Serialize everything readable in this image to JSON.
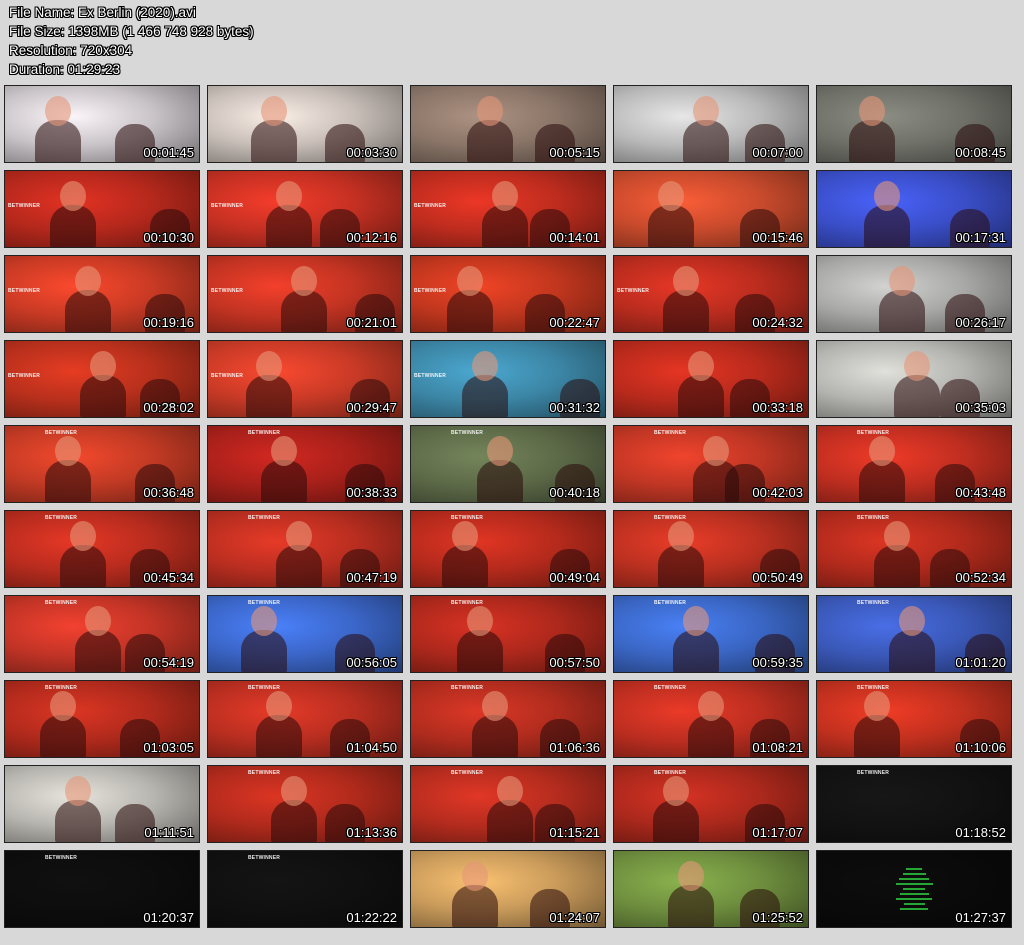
{
  "info": {
    "file_name": "File Name: Ex Berlin (2020).avi",
    "file_size": "File Size: 1398MB (1 466 748 928 bytes)",
    "resolution": "Resolution: 720x304",
    "duration": "Duration: 01:29:23"
  },
  "watermark": "BETWINNER",
  "thumbnails": [
    {
      "time": "00:01:45",
      "bg": "#c9c4c8",
      "tone": "light",
      "watermark": false
    },
    {
      "time": "00:03:30",
      "bg": "#c8beb8",
      "tone": "light",
      "watermark": false
    },
    {
      "time": "00:05:15",
      "bg": "#8a7568",
      "tone": "warm",
      "watermark": false
    },
    {
      "time": "00:07:00",
      "bg": "#b9b9b9",
      "tone": "light",
      "watermark": false
    },
    {
      "time": "00:08:45",
      "bg": "#6f7068",
      "tone": "dark",
      "watermark": false
    },
    {
      "time": "00:10:30",
      "bg": "#b5281c",
      "tone": "red",
      "watermark": true
    },
    {
      "time": "00:12:16",
      "bg": "#c43022",
      "tone": "red",
      "watermark": true
    },
    {
      "time": "00:14:01",
      "bg": "#bd2c1e",
      "tone": "red",
      "watermark": true
    },
    {
      "time": "00:15:46",
      "bg": "#c84a2c",
      "tone": "red",
      "watermark": false
    },
    {
      "time": "00:17:31",
      "bg": "#3a4ec8",
      "tone": "blue",
      "watermark": false
    },
    {
      "time": "00:19:16",
      "bg": "#c93a24",
      "tone": "red",
      "watermark": true
    },
    {
      "time": "00:21:01",
      "bg": "#c23322",
      "tone": "red",
      "watermark": true
    },
    {
      "time": "00:22:47",
      "bg": "#c0361e",
      "tone": "red",
      "watermark": true
    },
    {
      "time": "00:24:32",
      "bg": "#b92c1e",
      "tone": "red",
      "watermark": true
    },
    {
      "time": "00:26:17",
      "bg": "#a8a8a6",
      "tone": "light",
      "watermark": false
    },
    {
      "time": "00:28:02",
      "bg": "#b8301c",
      "tone": "red",
      "watermark": true
    },
    {
      "time": "00:29:47",
      "bg": "#c83a26",
      "tone": "red",
      "watermark": true
    },
    {
      "time": "00:31:32",
      "bg": "#3c86a6",
      "tone": "blue",
      "watermark": true
    },
    {
      "time": "00:33:18",
      "bg": "#b82a1c",
      "tone": "red",
      "watermark": false
    },
    {
      "time": "00:35:03",
      "bg": "#b4b4b0",
      "tone": "light",
      "watermark": false
    },
    {
      "time": "00:36:48",
      "bg": "#c23a24",
      "tone": "red",
      "watermark": true
    },
    {
      "time": "00:38:33",
      "bg": "#a8201a",
      "tone": "red",
      "watermark": true
    },
    {
      "time": "00:40:18",
      "bg": "#5d6a48",
      "tone": "green",
      "watermark": true
    },
    {
      "time": "00:42:03",
      "bg": "#c03624",
      "tone": "red",
      "watermark": true
    },
    {
      "time": "00:43:48",
      "bg": "#bf2e20",
      "tone": "red",
      "watermark": true
    },
    {
      "time": "00:45:34",
      "bg": "#b82c1e",
      "tone": "red",
      "watermark": true
    },
    {
      "time": "00:47:19",
      "bg": "#b92e20",
      "tone": "red",
      "watermark": true
    },
    {
      "time": "00:49:04",
      "bg": "#b42a1c",
      "tone": "red",
      "watermark": true
    },
    {
      "time": "00:50:49",
      "bg": "#ba3020",
      "tone": "red",
      "watermark": true
    },
    {
      "time": "00:52:34",
      "bg": "#b02a1c",
      "tone": "red",
      "watermark": true
    },
    {
      "time": "00:54:19",
      "bg": "#c23426",
      "tone": "red",
      "watermark": true
    },
    {
      "time": "00:56:05",
      "bg": "#3b66c8",
      "tone": "blue",
      "watermark": true
    },
    {
      "time": "00:57:50",
      "bg": "#ad281c",
      "tone": "red",
      "watermark": true
    },
    {
      "time": "00:59:35",
      "bg": "#3a66c4",
      "tone": "blue",
      "watermark": true
    },
    {
      "time": "01:01:20",
      "bg": "#3a58b8",
      "tone": "blue",
      "watermark": true
    },
    {
      "time": "01:03:05",
      "bg": "#b02a1c",
      "tone": "red",
      "watermark": true
    },
    {
      "time": "01:04:50",
      "bg": "#b82e20",
      "tone": "red",
      "watermark": true
    },
    {
      "time": "01:06:36",
      "bg": "#b02c1e",
      "tone": "red",
      "watermark": true
    },
    {
      "time": "01:08:21",
      "bg": "#bc2e20",
      "tone": "red",
      "watermark": true
    },
    {
      "time": "01:10:06",
      "bg": "#c0301e",
      "tone": "red",
      "watermark": true
    },
    {
      "time": "01:11:51",
      "bg": "#b8b6b0",
      "tone": "light",
      "watermark": false
    },
    {
      "time": "01:13:36",
      "bg": "#b02a1c",
      "tone": "red",
      "watermark": true
    },
    {
      "time": "01:15:21",
      "bg": "#b42c1e",
      "tone": "red",
      "watermark": true
    },
    {
      "time": "01:17:07",
      "bg": "#aa281c",
      "tone": "red",
      "watermark": true
    },
    {
      "time": "01:18:52",
      "bg": "#121212",
      "tone": "black",
      "watermark": true
    },
    {
      "time": "01:20:37",
      "bg": "#0d0d0d",
      "tone": "black",
      "watermark": true
    },
    {
      "time": "01:22:22",
      "bg": "#101010",
      "tone": "black",
      "watermark": true
    },
    {
      "time": "01:24:07",
      "bg": "#c89a5a",
      "tone": "mural",
      "watermark": false
    },
    {
      "time": "01:25:52",
      "bg": "#6e8e3e",
      "tone": "green",
      "watermark": false
    },
    {
      "time": "01:27:37",
      "bg": "#0a0a0a",
      "tone": "credits",
      "watermark": false
    }
  ]
}
